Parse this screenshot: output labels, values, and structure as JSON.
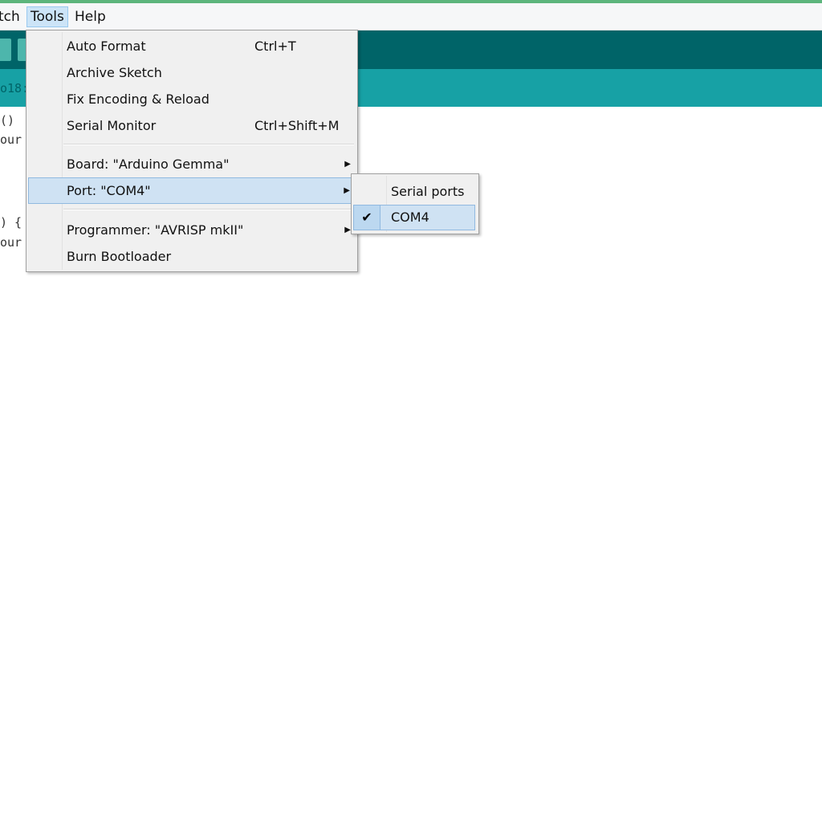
{
  "menubar": {
    "items": [
      "tch",
      "Tools",
      "Help"
    ]
  },
  "code_fragments": [
    "o18:",
    "()",
    "our",
    ") {",
    "our"
  ],
  "tools_menu": {
    "items": [
      {
        "label": "Auto Format",
        "shortcut": "Ctrl+T"
      },
      {
        "label": "Archive Sketch",
        "shortcut": ""
      },
      {
        "label": "Fix Encoding & Reload",
        "shortcut": ""
      },
      {
        "label": "Serial Monitor",
        "shortcut": "Ctrl+Shift+M"
      },
      {
        "label": "Board: \"Arduino Gemma\"",
        "submenu": true
      },
      {
        "label": "Port: \"COM4\"",
        "submenu": true,
        "highlighted": true
      },
      {
        "label": "Programmer: \"AVRISP mkII\"",
        "submenu": true
      },
      {
        "label": "Burn Bootloader"
      }
    ]
  },
  "port_submenu": {
    "header": "Serial ports",
    "items": [
      {
        "label": "COM4",
        "checked": true
      }
    ]
  },
  "colors": {
    "toolbar": "#006468",
    "tabbar": "#17a1a5",
    "highlight": "#cfe2f3"
  }
}
